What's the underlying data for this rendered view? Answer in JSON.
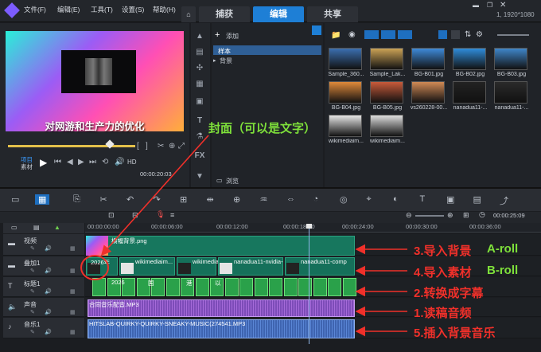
{
  "menu": {
    "file": "文件(F)",
    "edit": "编辑(E)",
    "tools": "工具(T)",
    "settings": "设置(S)",
    "help": "帮助(H)"
  },
  "tabs": {
    "capture": "捕获",
    "edit": "编辑",
    "share": "共享"
  },
  "resolution": "1, 1920*1080",
  "preview": {
    "subtitle": "对网游和生产力的优化",
    "project_label": "项目",
    "clip_label": "素材",
    "hd": "HD",
    "timecode": "00:00:20:03"
  },
  "library": {
    "add_label": "添加",
    "folders": [
      "样本",
      "背景"
    ],
    "browse_label": "浏览",
    "thumbnails": [
      {
        "label": "Sample_360...",
        "color": "#3b6fb0"
      },
      {
        "label": "Sample_Lak...",
        "color": "#caa255"
      },
      {
        "label": "BG-B01.jpg",
        "color": "#3e8ad8"
      },
      {
        "label": "BG-B02.jpg",
        "color": "#2f8cd9"
      },
      {
        "label": "BG-B03.jpg",
        "color": "#3f86c9"
      },
      {
        "label": "BG-B04.jpg",
        "color": "#e08a3a"
      },
      {
        "label": "BG-B05.jpg",
        "color": "#c85a3a"
      },
      {
        "label": "vs260228-00...",
        "color": "#d08a55"
      },
      {
        "label": "nanadua11-...",
        "color": "#222222"
      },
      {
        "label": "nanadua11-...",
        "color": "#2b2b2b"
      },
      {
        "label": "wikimediaim...",
        "color": "#e6e6e6"
      },
      {
        "label": "wikimediaim...",
        "color": "#dddddd"
      }
    ]
  },
  "timeline": {
    "timecode": "00:00:25:09",
    "ruler": [
      "00:00:00:00",
      "00:00:06:00",
      "00:00:12:00",
      "00:00:18:00",
      "00:00:24:00",
      "00:00:30:00",
      "00:00:36:00"
    ],
    "tracks": [
      {
        "name": "视频"
      },
      {
        "name": "叠加1"
      },
      {
        "name": "标题1"
      },
      {
        "name": "声音"
      },
      {
        "name": "音乐1"
      }
    ],
    "video_clip": "横幅背景.png",
    "overlay_clips": [
      "2026年",
      "wikimediaim...",
      "wikimediaimage",
      "nanadua11-nvidia-",
      "nanadua11-comp"
    ],
    "title_clip_prefix": "2026",
    "title_clip_chars": [
      "国",
      "港",
      "以"
    ],
    "voice_clip": "合同音乐配音.MP3",
    "music_clip": "HITSLAB-QUIRKY-QUIRKY-SNEAKY-MUSIC(274541.MP3"
  },
  "annotations": {
    "cover": "封面（可以是文字）",
    "bg": "3.导入背景",
    "a_roll": "A-roll",
    "material": "4.导入素材",
    "b_roll": "B-roll",
    "subtitle": "2.转换成字幕",
    "voice": "1.读稿音频",
    "music": "5.插入背景音乐"
  },
  "colors": {
    "accent": "#1e7fd6",
    "annotation_red": "#f0302a",
    "annotation_green": "#7ee03a"
  }
}
